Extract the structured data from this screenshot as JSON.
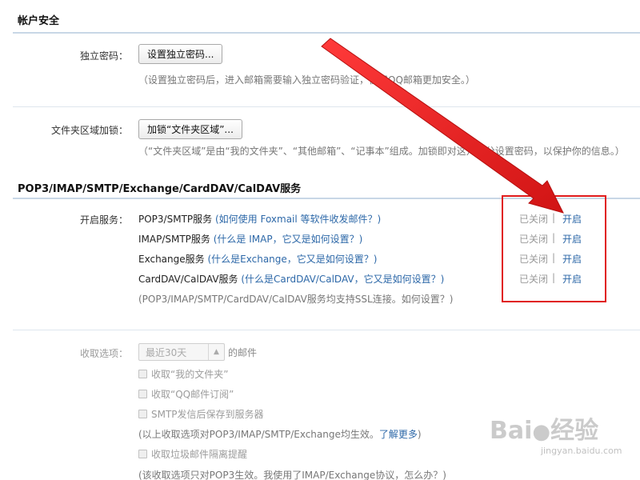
{
  "account_security": {
    "title": "帐户安全",
    "standalone_password": {
      "label": "独立密码：",
      "button": "设置独立密码...",
      "hint": "（设置独立密码后，进入邮箱需要输入独立密码验证，使用QQ邮箱更加安全。）"
    },
    "folder_lock": {
      "label": "文件夹区域加锁：",
      "button": "加锁“文件夹区域”...",
      "hint": "（“文件夹区域”是由“我的文件夹”、“其他邮箱”、“记事本”组成。加锁即对这几部分设置密码，以保护你的信息。）"
    }
  },
  "services": {
    "title": "POP3/IMAP/SMTP/Exchange/CardDAV/CalDAV服务",
    "label": "开启服务：",
    "items": [
      {
        "name": "POP3/SMTP服务",
        "help": "(如何使用 Foxmail 等软件收发邮件？)",
        "closed": "已关闭",
        "pipe": "|",
        "open": "开启"
      },
      {
        "name": "IMAP/SMTP服务",
        "help": "(什么是 IMAP，它又是如何设置？)",
        "closed": "已关闭",
        "pipe": "|",
        "open": "开启"
      },
      {
        "name": "Exchange服务",
        "help": "(什么是Exchange，它又是如何设置？)",
        "closed": "已关闭",
        "pipe": "|",
        "open": "开启"
      },
      {
        "name": "CardDAV/CalDAV服务",
        "help": "(什么是CardDAV/CalDAV，它又是如何设置？)",
        "closed": "已关闭",
        "pipe": "|",
        "open": "开启"
      }
    ],
    "ssl_note": "(POP3/IMAP/SMTP/CardDAV/CalDAV服务均支持SSL连接。如何设置？)"
  },
  "receive": {
    "label": "收取选项：",
    "select_value": "最近30天",
    "select_suffix": "的邮件",
    "checkbox_my_folders": "收取“我的文件夹”",
    "checkbox_qq_subscription": "收取“QQ邮件订阅”",
    "checkbox_smtp_save": "SMTP发信后保存到服务器",
    "note1_text": "(以上收取选项对POP3/IMAP/SMTP/Exchange均生效。",
    "note1_link": "了解更多",
    "note1_end": ")",
    "checkbox_spam": "收取垃圾邮件隔离提醒",
    "note2": "(该收取选项只对POP3生效。我使用了IMAP/Exchange协议，怎么办？)"
  },
  "watermark": {
    "brand": "Bai",
    "brand_end": "经验",
    "url": "jingyan.baidu.com"
  },
  "colors": {
    "accent_link": "#2d68a8",
    "highlight_box": "#e01a1a",
    "arrow": "#e32020",
    "heading_rule": "#c8d7e6"
  }
}
